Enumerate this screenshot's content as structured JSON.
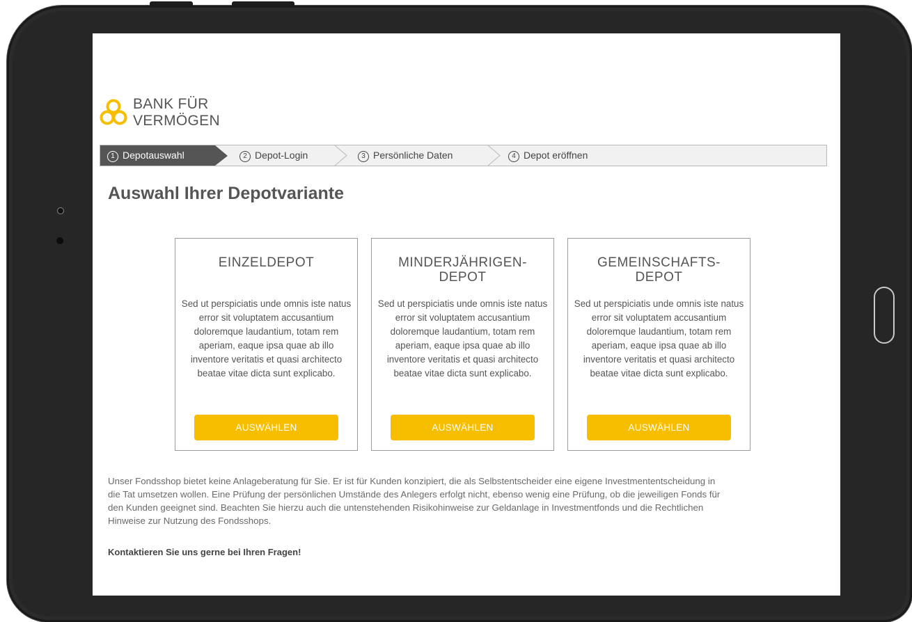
{
  "brand": {
    "line1": "BANK FÜR",
    "line2": "VERMÖGEN",
    "logo_color": "#f7be00"
  },
  "steps": [
    {
      "number": "1",
      "label": "Depotauswahl",
      "active": true
    },
    {
      "number": "2",
      "label": "Depot-Login",
      "active": false
    },
    {
      "number": "3",
      "label": "Persönliche Daten",
      "active": false
    },
    {
      "number": "4",
      "label": "Depot eröffnen",
      "active": false
    }
  ],
  "page_title": "Auswahl Ihrer Depotvariante",
  "cards": [
    {
      "title_line1": "EINZELDEPOT",
      "title_line2": "",
      "description": "Sed ut perspiciatis unde omnis iste natus error sit voluptatem accusantium doloremque laudantium, totam rem aperiam, eaque ipsa quae ab illo inventore veritatis et quasi architecto beatae vitae dicta sunt explicabo.",
      "button_label": "AUSWÄHLEN"
    },
    {
      "title_line1": "MINDERJÄHRIGEN-",
      "title_line2": "DEPOT",
      "description": "Sed ut perspiciatis unde omnis iste natus error sit voluptatem accusantium doloremque laudantium, totam rem aperiam, eaque ipsa quae ab illo inventore veritatis et quasi architecto beatae vitae dicta sunt explicabo.",
      "button_label": "AUSWÄHLEN"
    },
    {
      "title_line1": "GEMEINSCHAFTS-",
      "title_line2": "DEPOT",
      "description": "Sed ut perspiciatis unde omnis iste natus error sit voluptatem accusantium doloremque laudantium, totam rem aperiam, eaque ipsa quae ab illo inventore veritatis et quasi architecto beatae vitae dicta sunt explicabo.",
      "button_label": "AUSWÄHLEN"
    }
  ],
  "disclaimer": "Unser Fondsshop bietet keine Anlageberatung für Sie. Er ist für Kunden konzipiert, die als Selbstentscheider eine eigene Investmententscheidung in die Tat umsetzen wollen. Eine Prüfung der persönlichen Umstände des Anlegers erfolgt nicht, ebenso wenig eine Prüfung, ob die jeweiligen Fonds für den Kunden geeignet sind. Beachten Sie hierzu auch die untenstehenden Risikohinweise zur Geldanlage in Investmentfonds und die Rechtlichen Hinweise zur Nutzung des Fondsshops.",
  "contact": "Kontaktieren Sie uns gerne bei Ihren Fragen!",
  "colors": {
    "accent": "#f7be00",
    "active_step": "#555555",
    "text": "#555555"
  }
}
